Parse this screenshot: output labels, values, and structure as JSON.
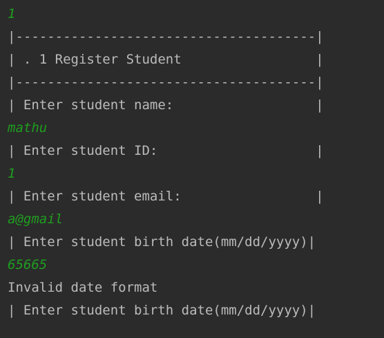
{
  "console": {
    "lines": [
      {
        "kind": "in",
        "text": "1"
      },
      {
        "kind": "out",
        "text": "|--------------------------------------|"
      },
      {
        "kind": "out",
        "text": "| . 1 Register Student                 |"
      },
      {
        "kind": "out",
        "text": "|--------------------------------------|"
      },
      {
        "kind": "out",
        "text": "| Enter student name:                  |"
      },
      {
        "kind": "in",
        "text": "mathu"
      },
      {
        "kind": "out",
        "text": "| Enter student ID:                    |"
      },
      {
        "kind": "in",
        "text": "1"
      },
      {
        "kind": "out",
        "text": "| Enter student email:                 |"
      },
      {
        "kind": "in",
        "text": "a@gmail"
      },
      {
        "kind": "out",
        "text": "| Enter student birth date(mm/dd/yyyy)|"
      },
      {
        "kind": "in",
        "text": "65665"
      },
      {
        "kind": "out",
        "text": "Invalid date format"
      },
      {
        "kind": "out",
        "text": "| Enter student birth date(mm/dd/yyyy)|"
      }
    ]
  },
  "colors": {
    "background": "#2b2b2b",
    "output_text": "#bbbbbb",
    "user_input_text": "#1f9e1f"
  }
}
